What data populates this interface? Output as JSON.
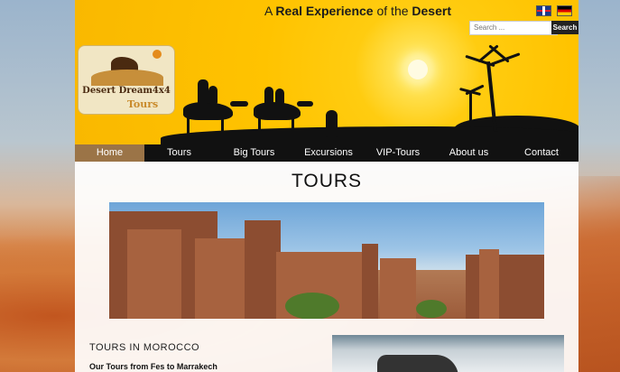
{
  "header": {
    "tagline_prefix": "A",
    "tagline_strong1": "Real Experience",
    "tagline_mid": "of the",
    "tagline_strong2": "Desert",
    "flags": [
      "uk-flag-icon",
      "germany-flag-icon"
    ],
    "search_placeholder": "Search ...",
    "search_button": "Search"
  },
  "logo": {
    "line1": "Desert Dream4x4",
    "line2": "Tours"
  },
  "nav": {
    "items": [
      {
        "label": "Home",
        "active": true
      },
      {
        "label": "Tours"
      },
      {
        "label": "Big Tours"
      },
      {
        "label": "Excursions"
      },
      {
        "label": "VIP-Tours"
      },
      {
        "label": "About us"
      },
      {
        "label": "Contact"
      }
    ]
  },
  "main": {
    "title": "TOURS",
    "section_heading": "TOURS IN MOROCCO",
    "sub_heading": "Our Tours from Fes to Marrakech"
  },
  "colors": {
    "header_yellow": "#ffc300",
    "nav_bg": "#111111",
    "nav_active": "#9b7447"
  }
}
